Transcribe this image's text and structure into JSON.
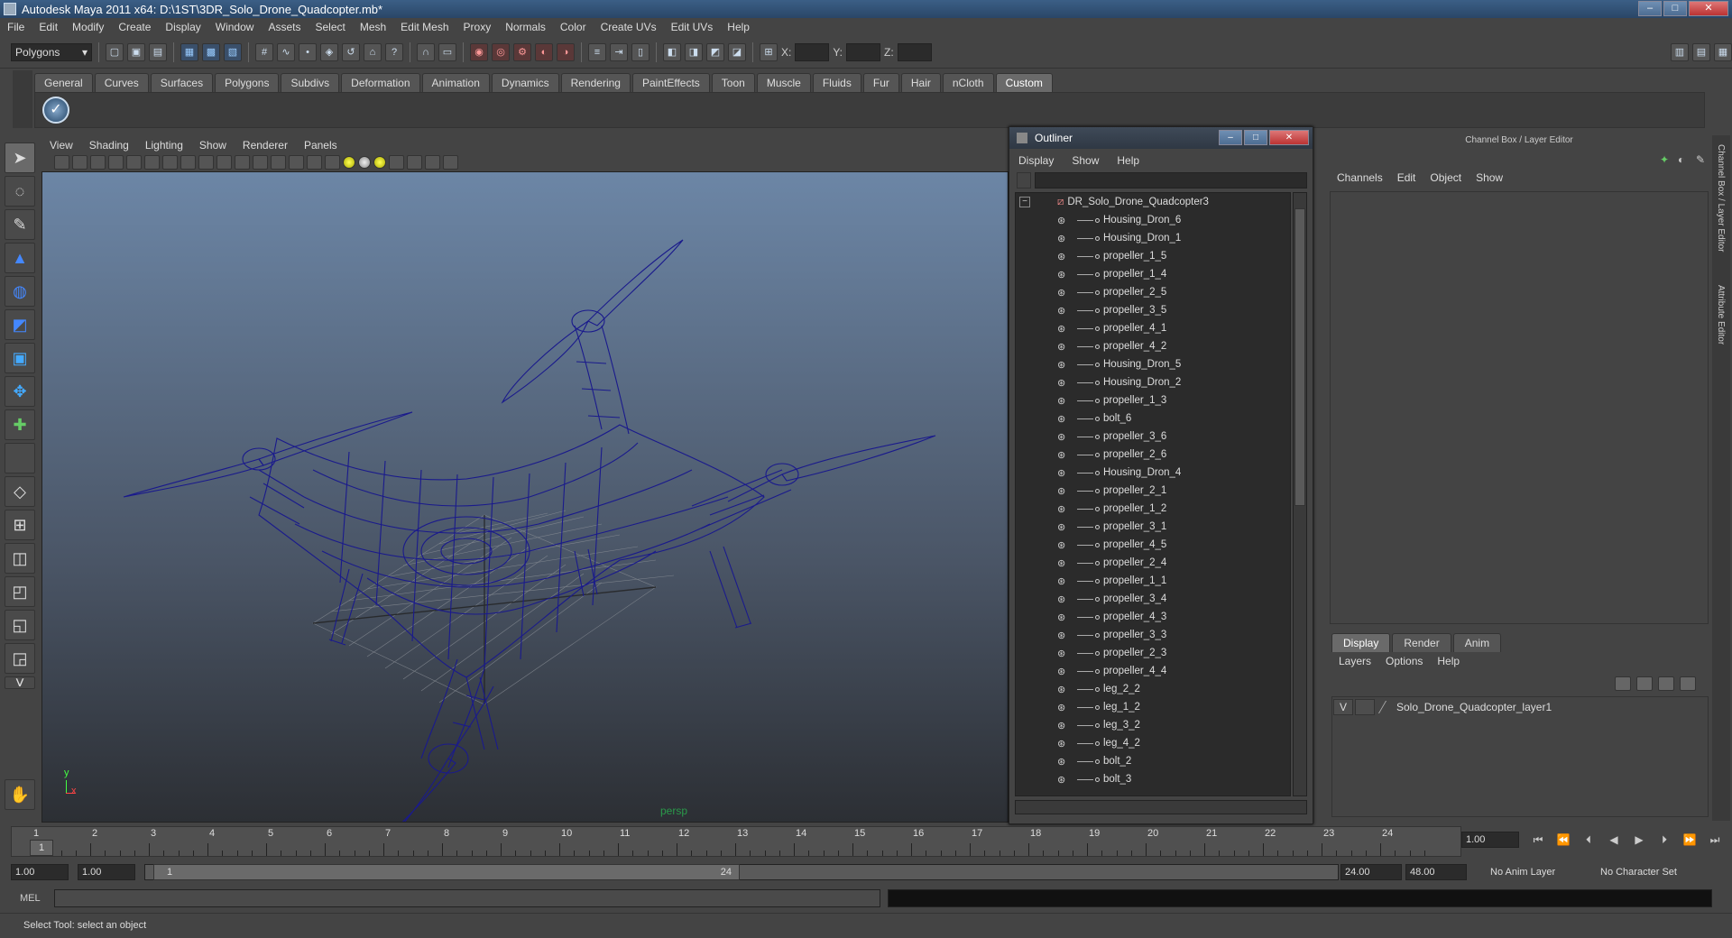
{
  "window": {
    "title": "Autodesk Maya 2011 x64: D:\\1ST\\3DR_Solo_Drone_Quadcopter.mb*"
  },
  "menubar": [
    "File",
    "Edit",
    "Modify",
    "Create",
    "Display",
    "Window",
    "Assets",
    "Select",
    "Mesh",
    "Edit Mesh",
    "Proxy",
    "Normals",
    "Color",
    "Create UVs",
    "Edit UVs",
    "Help"
  ],
  "statusline": {
    "mode": "Polygons",
    "x_label": "X:",
    "y_label": "Y:",
    "z_label": "Z:"
  },
  "shelf": {
    "tabs": [
      "General",
      "Curves",
      "Surfaces",
      "Polygons",
      "Subdivs",
      "Deformation",
      "Animation",
      "Dynamics",
      "Rendering",
      "PaintEffects",
      "Toon",
      "Muscle",
      "Fluids",
      "Fur",
      "Hair",
      "nCloth",
      "Custom"
    ],
    "active": "Custom"
  },
  "viewport": {
    "menu": [
      "View",
      "Shading",
      "Lighting",
      "Show",
      "Renderer",
      "Panels"
    ],
    "camera": "persp",
    "axis_y": "y",
    "axis_x": "x",
    "wire_color": "#1a1a8c"
  },
  "outliner": {
    "title": "Outliner",
    "menu": [
      "Display",
      "Show",
      "Help"
    ],
    "root": "DR_Solo_Drone_Quadcopter3",
    "items": [
      "Housing_Dron_6",
      "Housing_Dron_1",
      "propeller_1_5",
      "propeller_1_4",
      "propeller_2_5",
      "propeller_3_5",
      "propeller_4_1",
      "propeller_4_2",
      "Housing_Dron_5",
      "Housing_Dron_2",
      "propeller_1_3",
      "bolt_6",
      "propeller_3_6",
      "propeller_2_6",
      "Housing_Dron_4",
      "propeller_2_1",
      "propeller_1_2",
      "propeller_3_1",
      "propeller_4_5",
      "propeller_2_4",
      "propeller_1_1",
      "propeller_3_4",
      "propeller_4_3",
      "propeller_3_3",
      "propeller_2_3",
      "propeller_4_4",
      "leg_2_2",
      "leg_1_2",
      "leg_3_2",
      "leg_4_2",
      "bolt_2",
      "bolt_3"
    ]
  },
  "channelbox": {
    "title": "Channel Box / Layer Editor",
    "menu": [
      "Channels",
      "Edit",
      "Object",
      "Show"
    ]
  },
  "layer_editor": {
    "tabs": [
      "Display",
      "Render",
      "Anim"
    ],
    "active": "Display",
    "menu": [
      "Layers",
      "Options",
      "Help"
    ],
    "layer": {
      "visible": "V",
      "name": "Solo_Drone_Quadcopter_layer1"
    }
  },
  "side_tabs": [
    "Channel Box / Layer Editor",
    "Attribute Editor"
  ],
  "timeline": {
    "ticks": [
      "1",
      "2",
      "3",
      "4",
      "5",
      "6",
      "7",
      "8",
      "9",
      "10",
      "11",
      "12",
      "13",
      "14",
      "15",
      "16",
      "17",
      "18",
      "19",
      "20",
      "21",
      "22",
      "23",
      "24"
    ],
    "current": "1",
    "current_field": "1.00"
  },
  "range": {
    "start": "1.00",
    "start2": "1.00",
    "slider_start": "1",
    "slider_end": "24",
    "end": "24.00",
    "end2": "48.00",
    "anim_layer": "No Anim Layer",
    "char_set": "No Character Set"
  },
  "command": {
    "label": "MEL"
  },
  "help": {
    "text": "Select Tool: select an object"
  }
}
